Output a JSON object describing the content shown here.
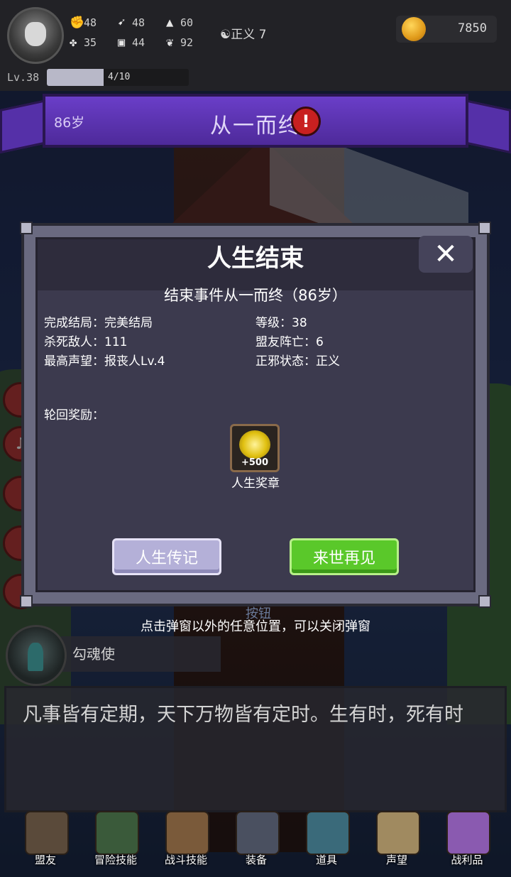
{
  "header": {
    "stats": [
      {
        "icon": "fist-icon",
        "value": "48"
      },
      {
        "icon": "boot-icon",
        "value": "48"
      },
      {
        "icon": "wizard-hat-icon",
        "value": "60"
      },
      {
        "icon": "clover-icon",
        "value": "35"
      },
      {
        "icon": "armor-icon",
        "value": "44"
      },
      {
        "icon": "sprout-icon",
        "value": "92"
      }
    ],
    "justice": "正义 7",
    "gold": "7850",
    "level": "Lv.38",
    "xp_text": "4/10",
    "xp_progress": 0.4
  },
  "banner": {
    "age": "86岁",
    "title": "从一而终"
  },
  "dialog": {
    "title": "人生结束",
    "event": "结束事件从一而终（86岁）",
    "info": [
      {
        "label": "完成结局：",
        "value": "完美结局"
      },
      {
        "label": "等级：",
        "value": "38"
      },
      {
        "label": "杀死敌人：",
        "value": "111"
      },
      {
        "label": "盟友阵亡：",
        "value": "6"
      },
      {
        "label": "最高声望：",
        "value": "报丧人Lv.4"
      },
      {
        "label": "正邪状态：",
        "value": "正义"
      }
    ],
    "reward_label": "轮回奖励：",
    "reward": {
      "amount": "+500",
      "name": "人生奖章"
    },
    "buttons": {
      "biography": "人生传记",
      "next_life": "来世再见"
    }
  },
  "hint": "点击弹窗以外的任意位置，可以关闭弹窗",
  "behind_text": "按钮",
  "npc": {
    "name": "勾魂使",
    "text": "凡事皆有定期，天下万物皆有定时。生有时，死有时"
  },
  "nav": [
    {
      "icon": "handshake-icon",
      "label": "盟友"
    },
    {
      "icon": "book-icon",
      "label": "冒险技能"
    },
    {
      "icon": "backpack-icon",
      "label": "战斗技能"
    },
    {
      "icon": "crossed-swords-icon",
      "label": "装备"
    },
    {
      "icon": "amulet-icon",
      "label": "道具"
    },
    {
      "icon": "scroll-icon",
      "label": "声望"
    },
    {
      "icon": "treasure-chest-icon",
      "label": "战利品"
    }
  ],
  "colors": {
    "banner": "#5530a8",
    "dialog_bg": "#3c3a4e",
    "button_green": "#5ac82a",
    "button_lavender": "#b4b0d8",
    "warning_red": "#c82020"
  }
}
